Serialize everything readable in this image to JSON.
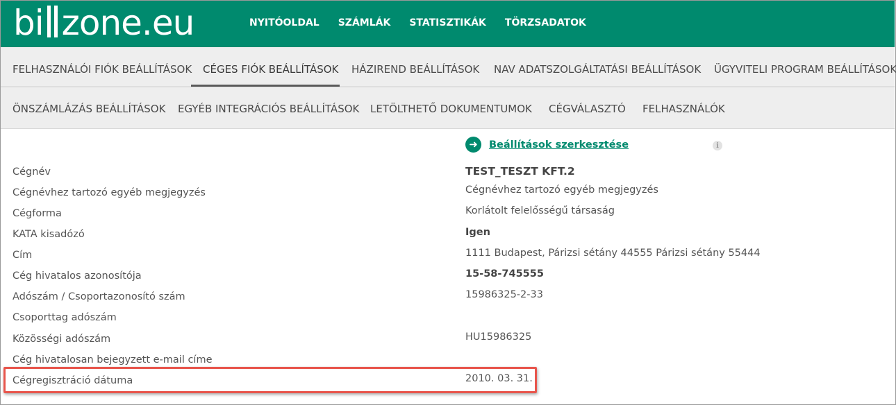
{
  "brand": {
    "logo_left": "bi",
    "logo_right": "zone.eu"
  },
  "main_nav": [
    "NYITÓOLDAL",
    "SZÁMLÁK",
    "STATISZTIKÁK",
    "TÖRZSADATOK"
  ],
  "tabs_row1": [
    "FELHASZNÁLÓI FIÓK BEÁLLÍTÁSOK",
    "CÉGES FIÓK BEÁLLÍTÁSOK",
    "HÁZIREND BEÁLLÍTÁSOK",
    "NAV ADATSZOLGÁLTATÁSI BEÁLLÍTÁSOK",
    "ÜGYVITELI PROGRAM BEÁLLÍTÁSOK"
  ],
  "tabs_row2": [
    "ÖNSZÁMLÁZÁS BEÁLLÍTÁSOK",
    "EGYÉB INTEGRÁCIÓS BEÁLLÍTÁSOK",
    "LETÖLTHETŐ DOKUMENTUMOK",
    "CÉGVÁLASZTÓ",
    "FELHASZNÁLÓK"
  ],
  "active_tab": "CÉGES FIÓK BEÁLLÍTÁSOK",
  "edit_link": "Beállítások szerkesztése",
  "info_glyph": "i",
  "fields": [
    {
      "label": "Cégnév",
      "value": "TEST_TESZT KFT.2"
    },
    {
      "label": "Cégnévhez tartozó egyéb megjegyzés",
      "value": "Cégnévhez tartozó egyéb megjegyzés"
    },
    {
      "label": "Cégforma",
      "value": "Korlátolt felelősségű társaság"
    },
    {
      "label": "KATA kisadózó",
      "value": "Igen"
    },
    {
      "label": "Cím",
      "value": "1111 Budapest, Párizsi sétány 44555 Párizsi sétány 55444"
    },
    {
      "label": "Cég hivatalos azonosítója",
      "value": "15-58-745555"
    },
    {
      "label": "Adószám / Csoportazonosító szám",
      "value": "15986325-2-33"
    },
    {
      "label": "Csoporttag adószám",
      "value": ""
    },
    {
      "label": "Közösségi adószám",
      "value": "HU15986325"
    },
    {
      "label": "Cég hivatalosan bejegyzett e-mail címe",
      "value": ""
    },
    {
      "label": "Cégregisztráció dátuma",
      "value": "2010. 03. 31."
    }
  ],
  "colors": {
    "brand_green": "#008a6e",
    "highlight_red": "#e8554c"
  }
}
